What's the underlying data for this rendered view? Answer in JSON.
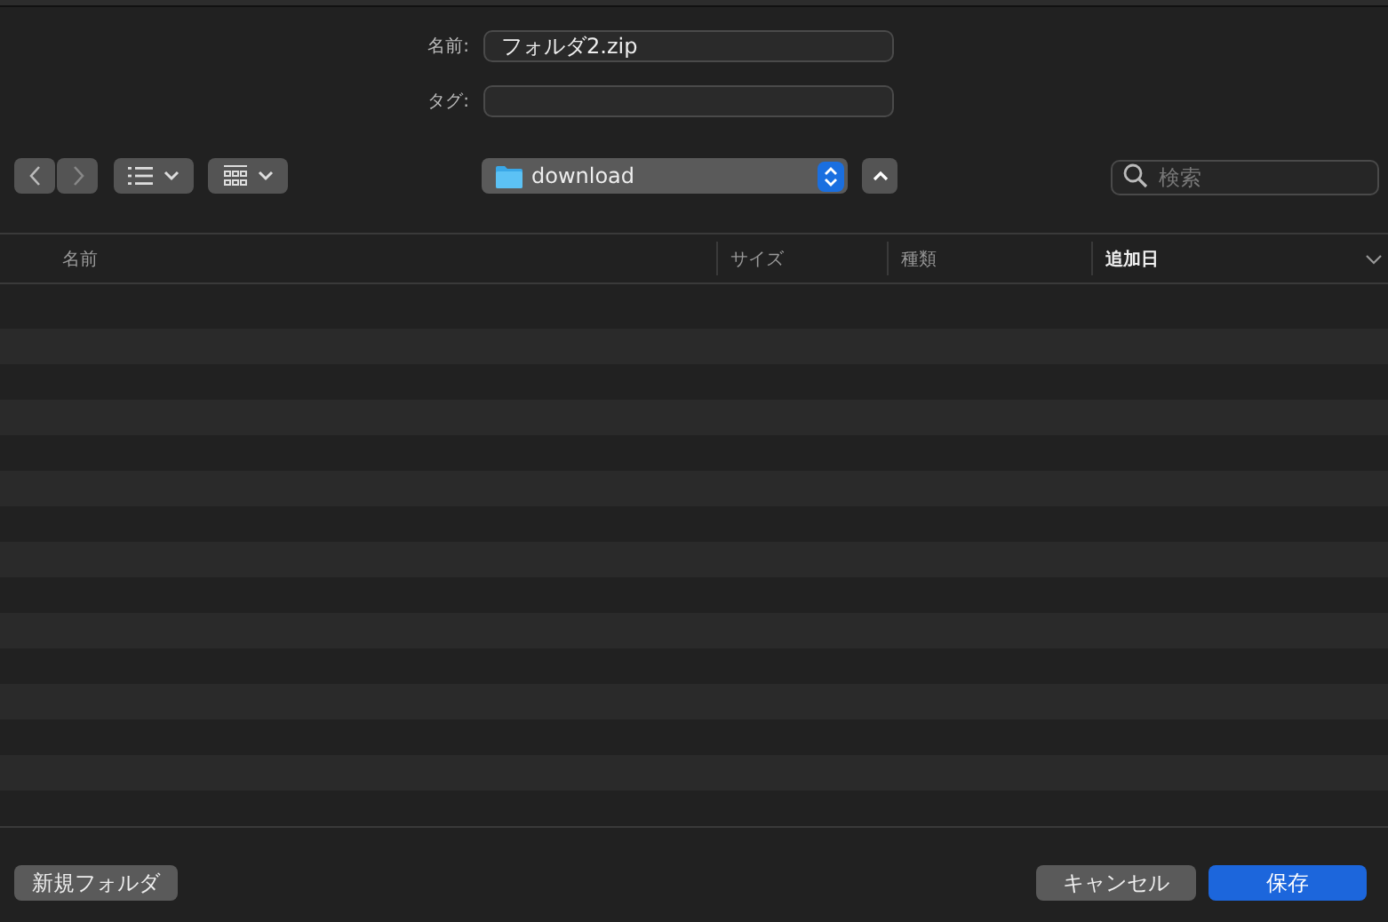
{
  "form": {
    "name_label": "名前:",
    "name_value": "フォルダ2.zip",
    "tags_label": "タグ:"
  },
  "toolbar": {
    "location": "download",
    "search_placeholder": "検索"
  },
  "table": {
    "columns": [
      {
        "label": "名前",
        "selected": false
      },
      {
        "label": "サイズ",
        "selected": false
      },
      {
        "label": "種類",
        "selected": false
      },
      {
        "label": "追加日",
        "selected": true
      }
    ]
  },
  "buttons": {
    "new_folder": "新規フォルダ",
    "cancel": "キャンセル",
    "save": "保存"
  }
}
